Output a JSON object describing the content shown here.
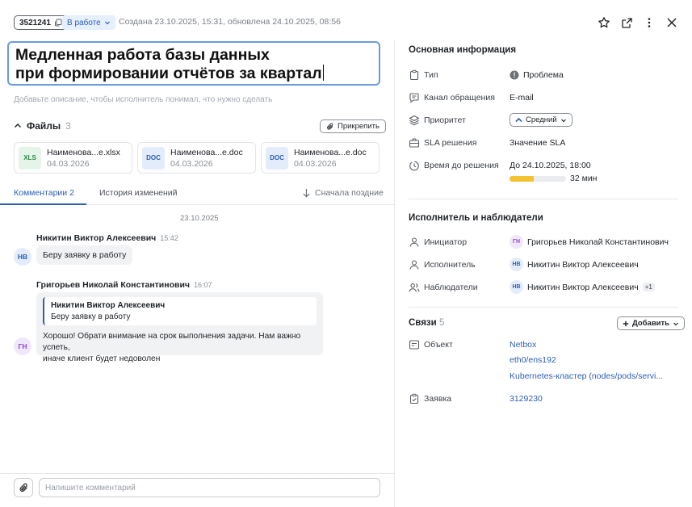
{
  "header": {
    "ticket_id": "3521241",
    "status": "В работе",
    "meta": "Создана 23.10.2025, 15:31, обновлена 24.10.2025, 08:56"
  },
  "title": "Медленная работа базы данных\nпри формировании отчётов за квартал",
  "description_placeholder": "Добавьте описание, чтобы исполнитель понимал, что нужно сделать",
  "files": {
    "label": "Файлы",
    "count": "3",
    "pin_label": "Прикрепить",
    "items": [
      {
        "type": "XLS",
        "name": "Наименова...e.xlsx",
        "date": "04.03.2026"
      },
      {
        "type": "DOC",
        "name": "Наименова...e.doc",
        "date": "04.03.2026"
      },
      {
        "type": "DOC",
        "name": "Наименова...e.doc",
        "date": "04.03.2026"
      }
    ]
  },
  "tabs": {
    "comments_label": "Комментарии",
    "comments_count": "2",
    "history_label": "История изменений",
    "sort_label": "Сначала поздние"
  },
  "comments": {
    "date": "23.10.2025",
    "items": [
      {
        "author": "Никитин Виктор Алексеевич",
        "time": "15:42",
        "initials": "НВ",
        "text": "Беру заявку в работу"
      },
      {
        "author": "Григорьев Николай Константинович",
        "time": "16:07",
        "initials": "ГН",
        "quote_author": "Никитин Виктор Алексеевич",
        "quote_text": "Беру заявку в работу",
        "text_line1": "Хорошо! Обрати внимание на срок выполнения задачи. Нам важно успеть,",
        "text_line2": "иначе клиент будет недоволен"
      }
    ]
  },
  "composer": {
    "placeholder": "Напишите комментарий"
  },
  "info": {
    "title": "Основная информация",
    "type_label": "Тип",
    "type_value": "Проблема",
    "channel_label": "Канал обращения",
    "channel_value": "E-mail",
    "priority_label": "Приоритет",
    "priority_value": "Средний",
    "sla_label": "SLA решения",
    "sla_value": "Значение SLA",
    "deadline_label": "Время до решения",
    "deadline_value": "До 24.10.2025, 18:00",
    "remaining": "32 мин",
    "progress": 0.43
  },
  "people": {
    "title": "Исполнитель и наблюдатели",
    "initiator_label": "Инициатор",
    "initiator_initials": "ГН",
    "initiator_name": "Григорьев Николай Константинович",
    "assignee_label": "Исполнитель",
    "assignee_initials": "НВ",
    "assignee_name": "Никитин Виктор Алексеевич",
    "watchers_label": "Наблюдатели",
    "watchers_initials": "НВ",
    "watchers_name": "Никитин Виктор Алексеевич",
    "watchers_more": "+1"
  },
  "links": {
    "title": "Связи",
    "count": "5",
    "add_label": "Добавить",
    "object_label": "Объект",
    "objects": [
      "Netbox",
      "eth0/ens192",
      "Kubernetes-кластер (nodes/pods/servi..."
    ],
    "ticket_label": "Заявка",
    "ticket_value": "3129230"
  },
  "colors": {
    "accent": "#2d5fb3",
    "progress": "#f2c230",
    "focus_border": "#6a9be0"
  }
}
